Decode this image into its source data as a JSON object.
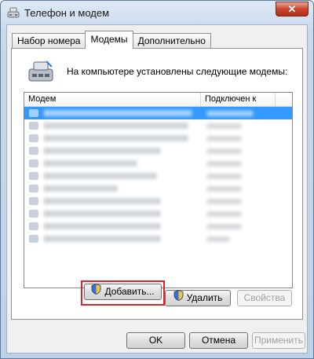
{
  "window": {
    "title": "Телефон и модем",
    "close_label": "✕"
  },
  "tabs": [
    {
      "label": "Набор номера",
      "active": false
    },
    {
      "label": "Модемы",
      "active": true
    },
    {
      "label": "Дополнительно",
      "active": false
    }
  ],
  "panel": {
    "header_text": "На компьютере установлены следующие модемы:",
    "list": {
      "columns": [
        "Модем",
        "Подключен к"
      ]
    }
  },
  "panel_buttons": {
    "add": "Добавить...",
    "remove": "Удалить",
    "properties": "Свойства"
  },
  "footer_buttons": {
    "ok": "OK",
    "cancel": "Отмена",
    "apply": "Применить"
  },
  "colors": {
    "selection": "#3399ff",
    "highlight_box": "#e0222b",
    "title_close": "#c8442c"
  },
  "icons": {
    "title": "phone-modem-icon",
    "header": "modem-phone-icon",
    "shield": "uac-shield-icon"
  }
}
